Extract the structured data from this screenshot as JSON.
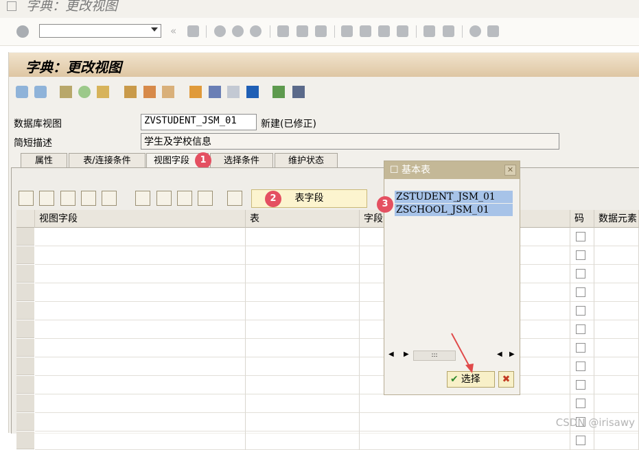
{
  "window": {
    "title": "字典：更改视图"
  },
  "header": {
    "title": "字典：更改视图"
  },
  "form": {
    "view_label": "数据库视图",
    "view_value": "ZVSTUDENT_JSM_01",
    "view_status": "新建(已修正)",
    "desc_label": "简短描述",
    "desc_value": "学生及学校信息"
  },
  "tabs": [
    {
      "label": "属性"
    },
    {
      "label": "表/连接条件"
    },
    {
      "label": "视图字段"
    },
    {
      "label": "选择条件"
    },
    {
      "label": "维护状态"
    }
  ],
  "table_fields_button": "表字段",
  "badges": [
    "1",
    "2",
    "3"
  ],
  "grid": {
    "columns": [
      "视图字段",
      "表",
      "字段",
      "码",
      "数据元素"
    ]
  },
  "popup": {
    "title": "基本表",
    "items": [
      "ZSTUDENT_JSM_01",
      "ZSCHOOL_JSM_01"
    ],
    "scroll_thumb": ":::",
    "choose_button": "选择"
  },
  "watermark": "CSDN @irisawy",
  "colors": {
    "badge": "#e45061",
    "header_bg": "#dec6a3",
    "selection": "#a7c3e8"
  }
}
